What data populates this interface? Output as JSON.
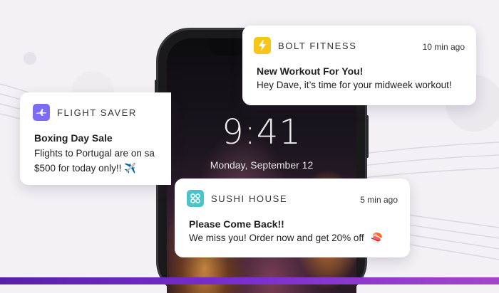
{
  "colors": {
    "bolt_icon": "#f5c518",
    "flight_icon": "#7c6cf0",
    "sushi_icon": "#4cc3c8",
    "bottom_bar": "#7b2fd0"
  },
  "lockscreen": {
    "time": "9:41",
    "date": "Monday, September 12"
  },
  "notifications": [
    {
      "app": "BOLT FITNESS",
      "icon": "lightning-bolt",
      "age": "10 min ago",
      "title": "New Workout For You!",
      "body": "Hey Dave, it’s time for your midweek workout!"
    },
    {
      "app": "FLIGHT SAVER",
      "icon": "airplane",
      "age": "",
      "title": "Boxing Day Sale",
      "body_line1": "Flights to Portugal are on sa",
      "body_line2": "$500 for today only!!",
      "emoji": "✈️"
    },
    {
      "app": "SUSHI HOUSE",
      "icon": "grid-dots",
      "age": "5 min ago",
      "title": "Please Come Back!!",
      "body": "We miss you! Order now and get 20% off",
      "emoji": "🍣"
    }
  ]
}
